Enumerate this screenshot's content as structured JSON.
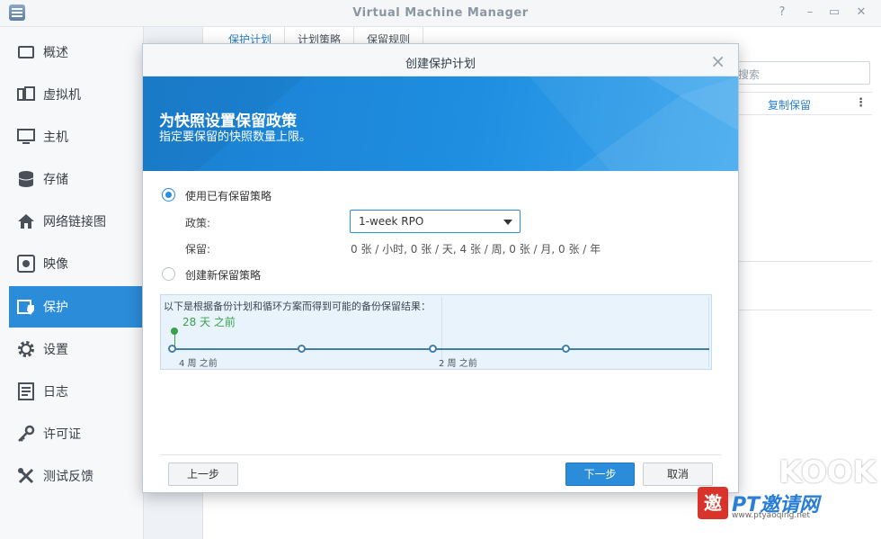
{
  "app": {
    "title": "Virtual Machine Manager",
    "controls": [
      "?",
      "–",
      "▭",
      "✕"
    ]
  },
  "sidebar": {
    "items": [
      {
        "label": "概述",
        "icon": "overview-icon"
      },
      {
        "label": "虚拟机",
        "icon": "virtual-machine-icon"
      },
      {
        "label": "主机",
        "icon": "host-icon"
      },
      {
        "label": "存储",
        "icon": "storage-icon"
      },
      {
        "label": "网络链接图",
        "icon": "network-icon"
      },
      {
        "label": "映像",
        "icon": "image-icon"
      },
      {
        "label": "保护",
        "icon": "protection-icon",
        "active": true
      },
      {
        "label": "设置",
        "icon": "settings-gear-icon"
      },
      {
        "label": "日志",
        "icon": "log-icon"
      },
      {
        "label": "许可证",
        "icon": "license-key-icon"
      },
      {
        "label": "测试反馈",
        "icon": "feedback-wrench-icon"
      }
    ]
  },
  "background": {
    "tabs": [
      "保护计划",
      "计划策略",
      "保留规则"
    ],
    "search_placeholder": "搜索",
    "column_header": "复制保留"
  },
  "modal": {
    "title": "创建保护计划",
    "banner_title": "为快照设置保留政策",
    "banner_subtitle": "指定要保留的快照数量上限。",
    "option_existing": "使用已有保留策略",
    "option_new": "创建新保留策略",
    "policy_label": "政策:",
    "policy_value": "1-week RPO",
    "retention_label": "保留:",
    "retention_value": "0 张 / 小时, 0 张 / 天, 4 张 / 周, 0 张 / 月, 0 张 / 年",
    "timeline": {
      "description": "以下是根据备份计划和循环方案而得到可能的备份保留结果：",
      "badge": "28 天 之前",
      "tick_left": "4 周 之前",
      "tick_mid": "2 周 之前"
    },
    "buttons": {
      "prev": "上一步",
      "next": "下一步",
      "cancel": "取消"
    }
  },
  "watermark": {
    "top": "KOOK",
    "box_char": "邀",
    "brand": "PT邀请网",
    "url": "www.ptyaoqing.net"
  },
  "colors": {
    "accent": "#2b8cd9",
    "banner": "#1f8ee0",
    "timeline_green": "#3aa148"
  }
}
